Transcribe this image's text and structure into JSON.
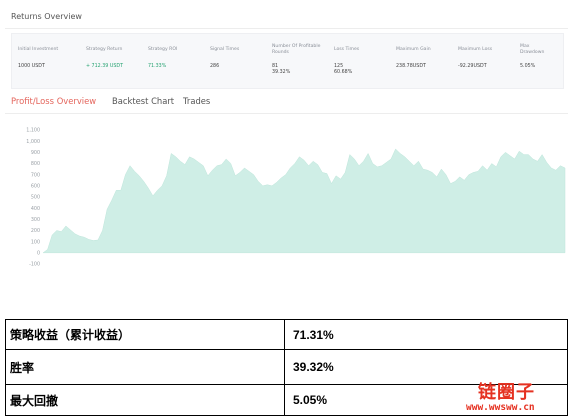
{
  "returns_overview": {
    "title": "Returns Overview",
    "columns": [
      {
        "header": "Initial Investment",
        "value": "1000 USDT",
        "color": "#444444"
      },
      {
        "header": "Strategy Return",
        "value": "+ 712.39 USDT",
        "color": "#27a372"
      },
      {
        "header": "Strategy ROI",
        "value": "71.33%",
        "color": "#27a372"
      },
      {
        "header": "Signal Times",
        "value": "286",
        "color": "#444444"
      },
      {
        "header": "Number Of Profitable\nRounds",
        "value": "81\n39.32%",
        "color": "#444444"
      },
      {
        "header": "Loss Times",
        "value": "125\n60.68%",
        "color": "#444444"
      },
      {
        "header": "Maximum Gain",
        "value": "238.78USDT",
        "color": "#444444"
      },
      {
        "header": "Maximum Loss",
        "value": "-92.29USDT",
        "color": "#444444"
      },
      {
        "header": "Max\nDrawdown",
        "value": "5.05%",
        "color": "#444444"
      }
    ]
  },
  "tabs": [
    {
      "label": "Profit/Loss Overview",
      "active": true
    },
    {
      "label": "Backtest Chart",
      "active": false
    },
    {
      "label": "Trades",
      "active": false
    }
  ],
  "colors": {
    "accent": "#e4655c",
    "profit": "#27a372",
    "area": "#cfeee6"
  },
  "chart_data": {
    "type": "area",
    "ylim": [
      -100,
      1100
    ],
    "yticks": [
      "1,100",
      "1,000",
      "900",
      "800",
      "700",
      "600",
      "500",
      "400",
      "300",
      "200",
      "100",
      "0",
      "-100"
    ],
    "values": [
      0,
      30,
      160,
      200,
      190,
      240,
      205,
      170,
      150,
      140,
      120,
      110,
      115,
      200,
      390,
      470,
      560,
      560,
      700,
      780,
      730,
      690,
      640,
      580,
      510,
      560,
      600,
      690,
      890,
      860,
      820,
      790,
      860,
      840,
      810,
      780,
      690,
      740,
      780,
      790,
      840,
      800,
      690,
      720,
      760,
      730,
      700,
      640,
      600,
      610,
      600,
      630,
      670,
      700,
      760,
      800,
      860,
      830,
      780,
      820,
      790,
      720,
      710,
      620,
      690,
      660,
      720,
      880,
      840,
      780,
      820,
      890,
      800,
      770,
      780,
      810,
      840,
      930,
      890,
      860,
      820,
      780,
      820,
      750,
      740,
      720,
      680,
      750,
      700,
      620,
      640,
      680,
      650,
      700,
      720,
      730,
      780,
      740,
      800,
      770,
      860,
      900,
      870,
      840,
      910,
      880,
      880,
      840,
      820,
      880,
      810,
      760,
      740,
      780,
      760
    ]
  },
  "summary_table": [
    {
      "label": "策略收益（累计收益）",
      "value": "71.31%"
    },
    {
      "label": "胜率",
      "value": "39.32%"
    },
    {
      "label": "最大回撤",
      "value": "5.05%"
    }
  ],
  "watermark": {
    "title": "链圈子",
    "url": "www.wwsww.cn"
  }
}
